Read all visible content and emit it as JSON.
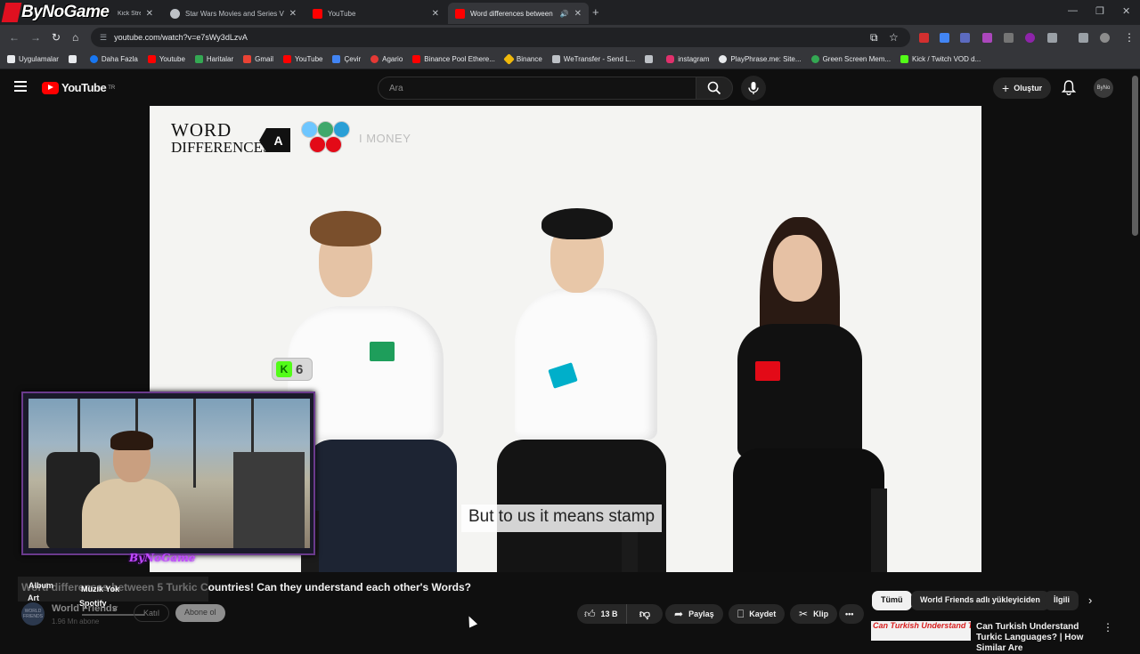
{
  "browser": {
    "tabs": [
      {
        "title": "Kick Stream - Watch Live",
        "active": false,
        "color": "#53fc18"
      },
      {
        "title": "Star Wars Movies and Series Vi",
        "active": false,
        "color": "#bdc1c6"
      },
      {
        "title": "YouTube",
        "active": false,
        "color": "#ff0000"
      },
      {
        "title": "Word differences between",
        "active": true,
        "color": "#ff0000"
      }
    ],
    "new_tab_icon": "plus-icon",
    "url": "youtube.com/watch?v=e7sWy3dLzvA",
    "bookmarks": [
      {
        "label": "Uygulamalar",
        "color": "#e8eaed"
      },
      {
        "label": "Daha Fazla",
        "color": "#1877f2"
      },
      {
        "label": "Youtube",
        "color": "#ff0000"
      },
      {
        "label": "Haritalar",
        "color": "#34a853"
      },
      {
        "label": "Gmail",
        "color": "#ea4335"
      },
      {
        "label": "YouTube",
        "color": "#ff0000"
      },
      {
        "label": "Çevir",
        "color": "#4285f4"
      },
      {
        "label": "Agario",
        "color": "#e53935"
      },
      {
        "label": "Binance Pool Ethere...",
        "color": "#ff0000"
      },
      {
        "label": "Binance",
        "color": "#f0b90b"
      },
      {
        "label": "WeTransfer - Send L...",
        "color": "#bdc1c6"
      },
      {
        "label": "",
        "color": "#bdc1c6"
      },
      {
        "label": "instagram",
        "color": "#e1306c"
      },
      {
        "label": "PlayPhrase.me: Site...",
        "color": "#e8eaed"
      },
      {
        "label": "Green Screen Mem...",
        "color": "#34a853"
      },
      {
        "label": "Kick / Twitch VOD d...",
        "color": "#53fc18"
      }
    ]
  },
  "youtube": {
    "logo_text": "YouTube",
    "region": "TR",
    "search_placeholder": "Ara",
    "create_label": "Oluştur",
    "avatar_text": "ByNo"
  },
  "video": {
    "brand_line1": "WORD",
    "brand_line2": "DIFFERENCES",
    "brand_box": "A",
    "topic": "I MONEY",
    "caption": "But to us it means stamp",
    "kick_count": "6",
    "flag_balls": [
      "#6ec6ff",
      "#3fa86b",
      "#2a9fd6",
      "#e30a17",
      "#e30a17"
    ]
  },
  "overlay": {
    "channel_logo": "ByNoGame",
    "streamer_name": "ByNoGame"
  },
  "below": {
    "title": "Word differences between 5 Turkic Countries! Can they understand each other's Words?",
    "music": {
      "album": "Album",
      "art": "Art",
      "status": "Müzik Yok",
      "source": "Spotify"
    },
    "channel_name": "World Friends",
    "channel_subs": "1.96 Mn abone",
    "channel_avatar": "WORLD FRIENDS",
    "join_label": "Katıl",
    "subscribe_label": "Abone ol",
    "like_count": "13 B",
    "share_label": "Paylaş",
    "save_label": "Kaydet",
    "clip_label": "Klip",
    "chips": [
      "Tümü",
      "World Friends adlı yükleyiciden",
      "İlgili"
    ],
    "rec_thumb_text": "Can Turkish Understand Them?",
    "rec_title": "Can Turkish Understand Turkic Languages? | How Similar Are"
  }
}
